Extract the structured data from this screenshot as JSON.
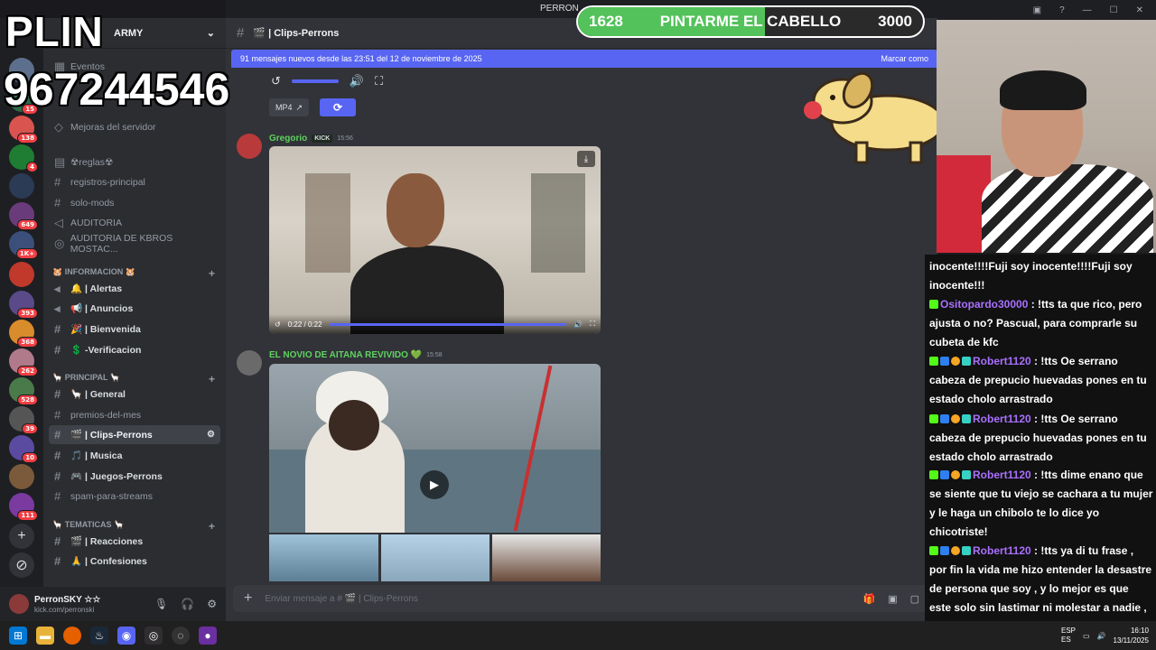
{
  "window": {
    "title_tab": "PERRON"
  },
  "stream_overlay": {
    "brand": "PLIN",
    "phone": "967244546",
    "goal": {
      "current": "1628",
      "label": "PINTARME EL CABELLO",
      "target": "3000",
      "progress": 0.543
    }
  },
  "server": {
    "name": "ARMY"
  },
  "sidebar": {
    "items": [
      {
        "label": "Eventos"
      },
      {
        "label": "Mejoras del servidor"
      },
      {
        "label": "☢reglas☢"
      },
      {
        "label": "registros-principal"
      },
      {
        "label": "solo-mods"
      },
      {
        "label": "AUDITORIA"
      },
      {
        "label": "AUDITORIA DE KBROS MOSTAC..."
      }
    ],
    "categories": [
      {
        "title": "🐹 INFORMACION 🐹",
        "channels": [
          "🔔 | Alertas",
          "📢 | Anuncios",
          "🎉 | Bienvenida",
          "💲 -Verificacion"
        ]
      },
      {
        "title": "🦙 PRINCIPAL 🦙",
        "channels": [
          "🦙 | General",
          "premios-del-mes",
          "🎬 | Clips-Perrons",
          "🎵 | Musica",
          "🎮 | Juegos-Perrons",
          "spam-para-streams"
        ]
      },
      {
        "title": "🦙 TEMATICAS 🦙",
        "channels": [
          "🎬 | Reacciones",
          "🙏 | Confesiones"
        ]
      }
    ]
  },
  "user_panel": {
    "name": "PerronSKY ☆☆",
    "sub": "kick.com/perronski"
  },
  "channel": {
    "title": "🎬 | Clips-Perrons",
    "banner_text": "91 mensajes nuevos desde las 23:51 del 12 de noviembre de 2025",
    "banner_action": "Marcar como",
    "mp4_label": "MP4",
    "composer_placeholder": "Enviar mensaje a # 🎬 | Clips-Perrons"
  },
  "messages": [
    {
      "author": "Gregorio",
      "tag": "KICK",
      "time": "15:56",
      "video_time": "0:22 / 0:22",
      "author_color": "#5fd35f"
    },
    {
      "author": "EL NOVIO DE AITANA REVIVIDO 💚",
      "time": "15:58",
      "author_color": "#5fd35f"
    }
  ],
  "rail_badges": [
    "1",
    "15",
    "138",
    "4",
    "649",
    "1K+",
    "393",
    "368",
    "262",
    "528",
    "39",
    "10",
    "111"
  ],
  "chat": [
    {
      "user": "",
      "text": "inocente!!!!Fuji soy inocente!!!!Fuji soy inocente!!!"
    },
    {
      "user": "Ositopardo30000",
      "text": " : !tts ta que rico, pero ajusta o no? Pascual, para comprarle su cubeta de kfc"
    },
    {
      "user": "Robert1120",
      "text": " : !tts Oe serrano cabeza de prepucio huevadas pones en tu estado cholo arrastrado"
    },
    {
      "user": "Robert1120",
      "text": " : !tts Oe serrano cabeza de prepucio huevadas pones en tu estado cholo arrastrado"
    },
    {
      "user": "Robert1120",
      "text": " : !tts dime enano que se siente que tu viejo se cachara a tu mujer y le haga un chibolo te lo dice yo chicotriste!"
    },
    {
      "user": "Robert1120",
      "text": " : !tts ya di tu frase , por fin la vida me hizo entender la desastre de persona que soy , y lo mejor es que este solo sin lastimar ni molestar a nadie , emo de mierda así quieres conquistar a esa mujer"
    }
  ],
  "tray": {
    "lang": "ESP",
    "lang2": "ES",
    "time": "16:10",
    "date": "13/11/2025"
  }
}
